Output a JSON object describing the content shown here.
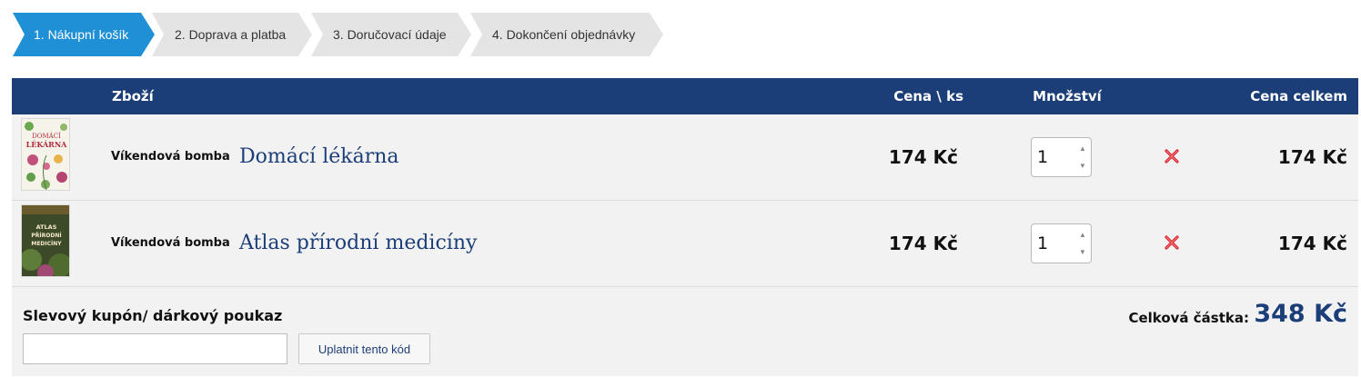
{
  "steps": [
    {
      "label": "1. Nákupní košík",
      "active": true
    },
    {
      "label": "2. Doprava a platba",
      "active": false
    },
    {
      "label": "3. Doručovací údaje",
      "active": false
    },
    {
      "label": "4. Dokončení objednávky",
      "active": false
    }
  ],
  "table": {
    "headers": {
      "goods": "Zboží",
      "unit_price": "Cena \\ ks",
      "quantity": "Množství",
      "total": "Cena celkem"
    },
    "rows": [
      {
        "badge": "Víkendová bomba",
        "name": "Domácí lékárna",
        "cover_text": [
          "DOMÁCÍ",
          "LÉKÁRNA"
        ],
        "unit_price": "174 Kč",
        "quantity": "1",
        "total": "174 Kč"
      },
      {
        "badge": "Víkendová bomba",
        "name": "Atlas přírodní medicíny",
        "cover_text": [
          "ATLAS",
          "PŘÍRODNÍ",
          "MEDICÍNY"
        ],
        "unit_price": "174 Kč",
        "quantity": "1",
        "total": "174 Kč"
      }
    ]
  },
  "coupon": {
    "label": "Slevový kupón/ dárkový poukaz",
    "value": "",
    "button": "Uplatnit tento kód"
  },
  "summary": {
    "label": "Celková částka:",
    "value": "348 Kč"
  },
  "colors": {
    "primary": "#1c3e78",
    "step_active": "#1f8fd6",
    "step_inactive": "#e4e4e4",
    "remove": "#d9232d"
  },
  "icons": {
    "remove": "red-x-icon",
    "spinner": "up-down-arrows"
  }
}
